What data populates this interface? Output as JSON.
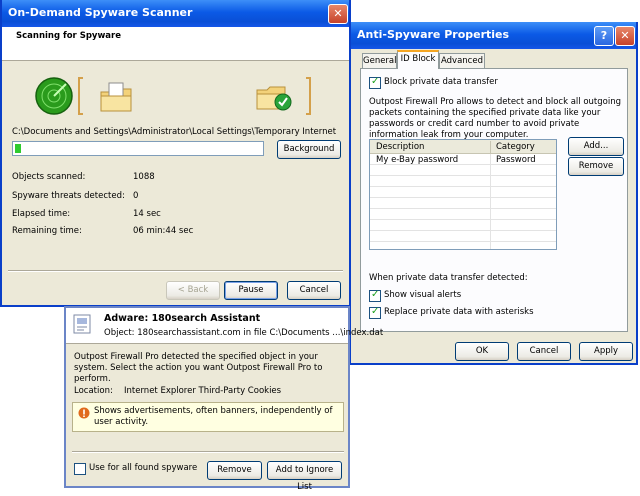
{
  "scanner": {
    "title": "On-Demand Spyware Scanner",
    "heading": "Scanning for Spyware",
    "path": "C:\\Documents and Settings\\Administrator\\Local Settings\\Temporary Internet",
    "progress": 0.03,
    "background_label": "Background",
    "stats": [
      {
        "label": "Objects scanned:",
        "value": "1088"
      },
      {
        "label": "Spyware threats detected:",
        "value": "0"
      },
      {
        "label": "Elapsed time:",
        "value": "14 sec"
      },
      {
        "label": "Remaining time:",
        "value": "06 min:44 sec"
      }
    ],
    "back_label": "< Back",
    "pause_label": "Pause",
    "cancel_label": "Cancel"
  },
  "props": {
    "title": "Anti-Spyware Properties",
    "help_glyph": "?",
    "close_glyph": "✕",
    "tabs": [
      "General",
      "ID Block",
      "Advanced"
    ],
    "block_label": "Block private data transfer",
    "description": "Outpost Firewall Pro allows to detect and block all outgoing packets containing the specified private data like your passwords or credit card number to avoid private information leak from your computer.",
    "columns": [
      "Description",
      "Category"
    ],
    "rows": [
      {
        "description": "My e-Bay password",
        "category": "Password"
      }
    ],
    "add_label": "Add...",
    "remove_label": "Remove",
    "when_label": "When private data transfer detected:",
    "visual_label": "Show visual alerts",
    "replace_label": "Replace private data with asterisks",
    "ok_label": "OK",
    "cancel_label": "Cancel",
    "apply_label": "Apply"
  },
  "alert": {
    "title": "Adware: 180search Assistant",
    "object": "Object: 180searchassistant.com in file C:\\Documents ...\\index.dat",
    "message": "Outpost Firewall Pro detected the specified object in your system. Select the action you want Outpost Firewall Pro to perform.",
    "location_label": "Location:",
    "location_value": "Internet Explorer Third-Party Cookies",
    "info": "Shows advertisements, often banners, independently of user activity.",
    "use_all_label": "Use for all found spyware",
    "remove_label": "Remove",
    "ignore_label": "Add to Ignore List"
  }
}
